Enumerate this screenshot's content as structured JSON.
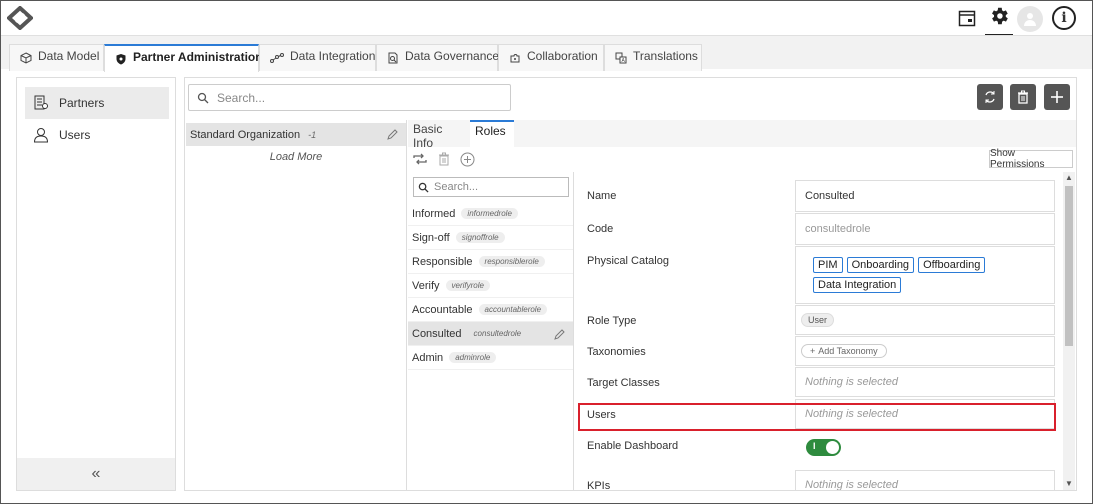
{
  "tabs": [
    {
      "label": "Data Model",
      "icon": "cube-icon"
    },
    {
      "label": "Partner Administration",
      "icon": "shield-icon"
    },
    {
      "label": "Data Integration",
      "icon": "nodes-icon"
    },
    {
      "label": "Data Governance",
      "icon": "document-search-icon"
    },
    {
      "label": "Collaboration",
      "icon": "puzzle-icon"
    },
    {
      "label": "Translations",
      "icon": "translate-icon"
    }
  ],
  "sidebar": {
    "items": [
      {
        "label": "Partners",
        "icon": "partners-icon"
      },
      {
        "label": "Users",
        "icon": "user-icon"
      }
    ],
    "collapse_glyph": "«"
  },
  "search": {
    "placeholder": "Search..."
  },
  "organizations": {
    "items": [
      {
        "name": "Standard Organization",
        "count": "-1"
      }
    ],
    "load_more": "Load More"
  },
  "subtabs": [
    "Basic Info",
    "Roles"
  ],
  "show_permissions": "Show Permissions",
  "roles_search": {
    "placeholder": "Search..."
  },
  "roles": [
    {
      "name": "Informed",
      "code": "informedrole"
    },
    {
      "name": "Sign-off",
      "code": "signoffrole"
    },
    {
      "name": "Responsible",
      "code": "responsiblerole"
    },
    {
      "name": "Verify",
      "code": "verifyrole"
    },
    {
      "name": "Accountable",
      "code": "accountablerole"
    },
    {
      "name": "Consulted",
      "code": "consultedrole"
    },
    {
      "name": "Admin",
      "code": "adminrole"
    }
  ],
  "details": {
    "name": {
      "label": "Name",
      "value": "Consulted"
    },
    "code": {
      "label": "Code",
      "value": "consultedrole"
    },
    "physical_catalog": {
      "label": "Physical Catalog",
      "chips": [
        "PIM",
        "Onboarding",
        "Offboarding",
        "Data Integration"
      ]
    },
    "role_type": {
      "label": "Role Type",
      "value": "User"
    },
    "taxonomies": {
      "label": "Taxonomies",
      "add_label": "Add Taxonomy"
    },
    "target_classes": {
      "label": "Target Classes",
      "placeholder": "Nothing is selected"
    },
    "users": {
      "label": "Users",
      "placeholder": "Nothing is selected"
    },
    "enable_dashboard": {
      "label": "Enable Dashboard",
      "toggle_text": "I",
      "on": true
    },
    "kpis": {
      "label": "KPIs",
      "placeholder": "Nothing is selected"
    }
  },
  "colors": {
    "accent": "#2b7bd6",
    "highlight": "#d9202c",
    "toggle_on": "#2e8b3e"
  }
}
